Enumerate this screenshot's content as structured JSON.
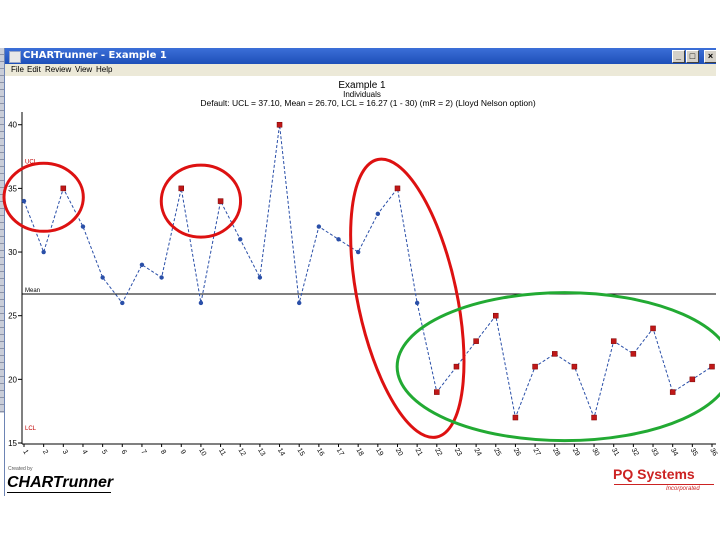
{
  "window": {
    "title": "CHARTrunner - Example 1",
    "buttons": [
      "_",
      "□",
      "×"
    ]
  },
  "menu": {
    "items": [
      "File",
      "Edit",
      "Review",
      "View",
      "Help"
    ]
  },
  "chart_header": {
    "title": "Example 1",
    "subtitle": "Individuals",
    "params": "Default: UCL = 37.10, Mean = 26.70, LCL = 16.27 (1 - 30) (mR = 2) (Lloyd Nelson option)"
  },
  "chart_data": {
    "type": "line",
    "title": "Example 1",
    "subtitle": "Individuals",
    "x": [
      1,
      2,
      3,
      4,
      5,
      6,
      7,
      8,
      9,
      10,
      11,
      12,
      13,
      14,
      15,
      16,
      17,
      18,
      19,
      20,
      21,
      22,
      23,
      24,
      25,
      26,
      27,
      28,
      29,
      30,
      31,
      32,
      33,
      34,
      35,
      36
    ],
    "values": [
      34,
      30,
      35,
      32,
      28,
      26,
      29,
      28,
      35,
      26,
      34,
      31,
      28,
      40,
      26,
      32,
      31,
      30,
      33,
      35,
      26,
      19,
      21,
      23,
      25,
      17,
      21,
      22,
      21,
      17,
      23,
      22,
      24,
      19,
      20,
      21
    ],
    "flagged_points": [
      3,
      9,
      11,
      14,
      20,
      22,
      23,
      24,
      25,
      26,
      27,
      28,
      29,
      30,
      31,
      32,
      33,
      34,
      35,
      36
    ],
    "ylim": [
      15,
      41
    ],
    "yticks": [
      15,
      20,
      25,
      30,
      35,
      40
    ],
    "control_limits": {
      "UCL": 37.1,
      "Mean": 26.7,
      "LCL": 16.27
    },
    "limit_labels": {
      "ucl": "UCL",
      "mean": "Mean",
      "lcl": "LCL"
    },
    "series_color": "#2a4fa8",
    "flag_color": "#c01818",
    "annotations": [
      {
        "shape": "ellipse",
        "color": "#dd1111",
        "around_x": [
          1,
          3
        ]
      },
      {
        "shape": "ellipse",
        "color": "#dd1111",
        "around_x": [
          9,
          11
        ]
      },
      {
        "shape": "ellipse",
        "color": "#dd1111",
        "around_x": [
          19,
          22
        ]
      },
      {
        "shape": "ellipse",
        "color": "#22aa33",
        "around_x": [
          21,
          36
        ]
      }
    ]
  },
  "footer": {
    "brand_tagline": "Created by",
    "brand": "CHARTrunner",
    "company": "PQ Systems",
    "company_sub": "Incorporated"
  }
}
